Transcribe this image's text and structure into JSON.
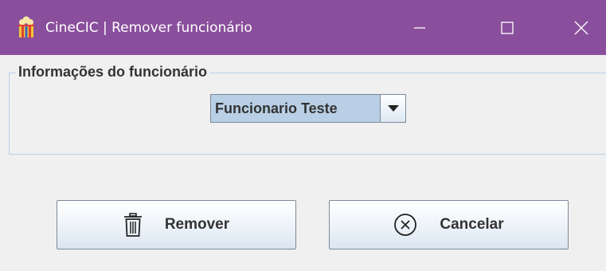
{
  "window": {
    "title": "CineCIC | Remover funcionário",
    "app_icon": "cinema-icon",
    "controls": [
      "minimize-icon",
      "maximize-icon",
      "close-icon"
    ],
    "titlebar_color": "#8a4f9c"
  },
  "panel": {
    "legend": "Informações do funcionário",
    "employee_select": {
      "selected": "Funcionario Teste",
      "arrow_icon": "chevron-down-icon"
    }
  },
  "actions": {
    "remove_label": "Remover",
    "remove_icon": "trash-icon",
    "cancel_label": "Cancelar",
    "cancel_icon": "close-circle-icon"
  }
}
